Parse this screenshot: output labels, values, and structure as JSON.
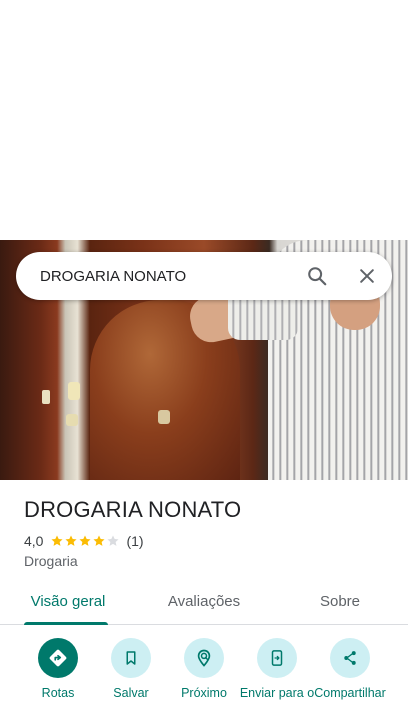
{
  "search": {
    "query": "DROGARIA NONATO"
  },
  "place": {
    "name": "DROGARIA NONATO",
    "rating": "4,0",
    "rating_value": 4,
    "rating_max": 5,
    "review_count": "(1)",
    "category": "Drogaria"
  },
  "tabs": [
    {
      "label": "Visão geral",
      "active": true
    },
    {
      "label": "Avaliações",
      "active": false
    },
    {
      "label": "Sobre",
      "active": false
    }
  ],
  "actions": [
    {
      "label": "Rotas",
      "icon": "directions-icon"
    },
    {
      "label": "Salvar",
      "icon": "bookmark-icon"
    },
    {
      "label": "Próximo",
      "icon": "nearby-icon"
    },
    {
      "label": "Enviar para o",
      "icon": "send-to-phone-icon"
    },
    {
      "label": "Compartilhar",
      "icon": "share-icon"
    }
  ],
  "colors": {
    "accent": "#00796b",
    "star": "#fbbc04",
    "star_empty": "#dadce0",
    "action_bg": "#cdeff3"
  }
}
